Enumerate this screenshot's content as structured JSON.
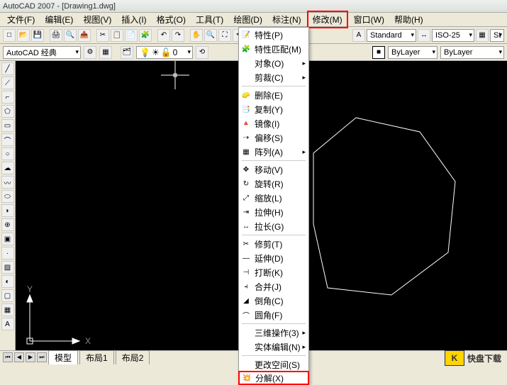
{
  "title": "AutoCAD 2007 - [Drawing1.dwg]",
  "menubar": [
    "文件(F)",
    "编辑(E)",
    "视图(V)",
    "插入(I)",
    "格式(O)",
    "工具(T)",
    "绘图(D)",
    "标注(N)",
    "修改(M)",
    "窗口(W)",
    "帮助(H)"
  ],
  "menubar_highlight_index": 8,
  "workspace_select": "AutoCAD 经典",
  "layer_select": "0",
  "style_select": "Standard",
  "dimstyle_select": "ISO-25",
  "prop_select1": "ByLayer",
  "prop_select2": "ByLayer",
  "prop_select3": "St",
  "dropdown": {
    "groups": [
      [
        {
          "icon": "📝",
          "label": "特性(P)"
        },
        {
          "icon": "🧩",
          "label": "特性匹配(M)"
        },
        {
          "icon": "",
          "label": "对象(O)",
          "arrow": true
        },
        {
          "icon": "",
          "label": "剪裁(C)",
          "arrow": true
        }
      ],
      [
        {
          "icon": "🧽",
          "label": "删除(E)"
        },
        {
          "icon": "📑",
          "label": "复制(Y)"
        },
        {
          "icon": "🔺",
          "label": "镜像(I)"
        },
        {
          "icon": "⇢",
          "label": "偏移(S)"
        },
        {
          "icon": "▦",
          "label": "阵列(A)",
          "arrow": true
        }
      ],
      [
        {
          "icon": "✥",
          "label": "移动(V)"
        },
        {
          "icon": "↻",
          "label": "旋转(R)"
        },
        {
          "icon": "⤢",
          "label": "缩放(L)"
        },
        {
          "icon": "⇥",
          "label": "拉伸(H)"
        },
        {
          "icon": "↔",
          "label": "拉长(G)"
        }
      ],
      [
        {
          "icon": "✂",
          "label": "修剪(T)"
        },
        {
          "icon": "—",
          "label": "延伸(D)"
        },
        {
          "icon": "⊣",
          "label": "打断(K)"
        },
        {
          "icon": "⫞",
          "label": "合并(J)"
        },
        {
          "icon": "◢",
          "label": "倒角(C)"
        },
        {
          "icon": "⌒",
          "label": "圆角(F)"
        }
      ],
      [
        {
          "icon": "",
          "label": "三维操作(3)",
          "arrow": true
        },
        {
          "icon": "",
          "label": "实体编辑(N)",
          "arrow": true
        }
      ],
      [
        {
          "icon": "",
          "label": "更改空间(S)"
        },
        {
          "icon": "💥",
          "label": "分解(X)",
          "highlight": true
        }
      ]
    ]
  },
  "axis": {
    "x": "X",
    "y": "Y"
  },
  "tabs": {
    "model": "模型",
    "layout1": "布局1",
    "layout2": "布局2"
  },
  "watermark": "快盘下载"
}
